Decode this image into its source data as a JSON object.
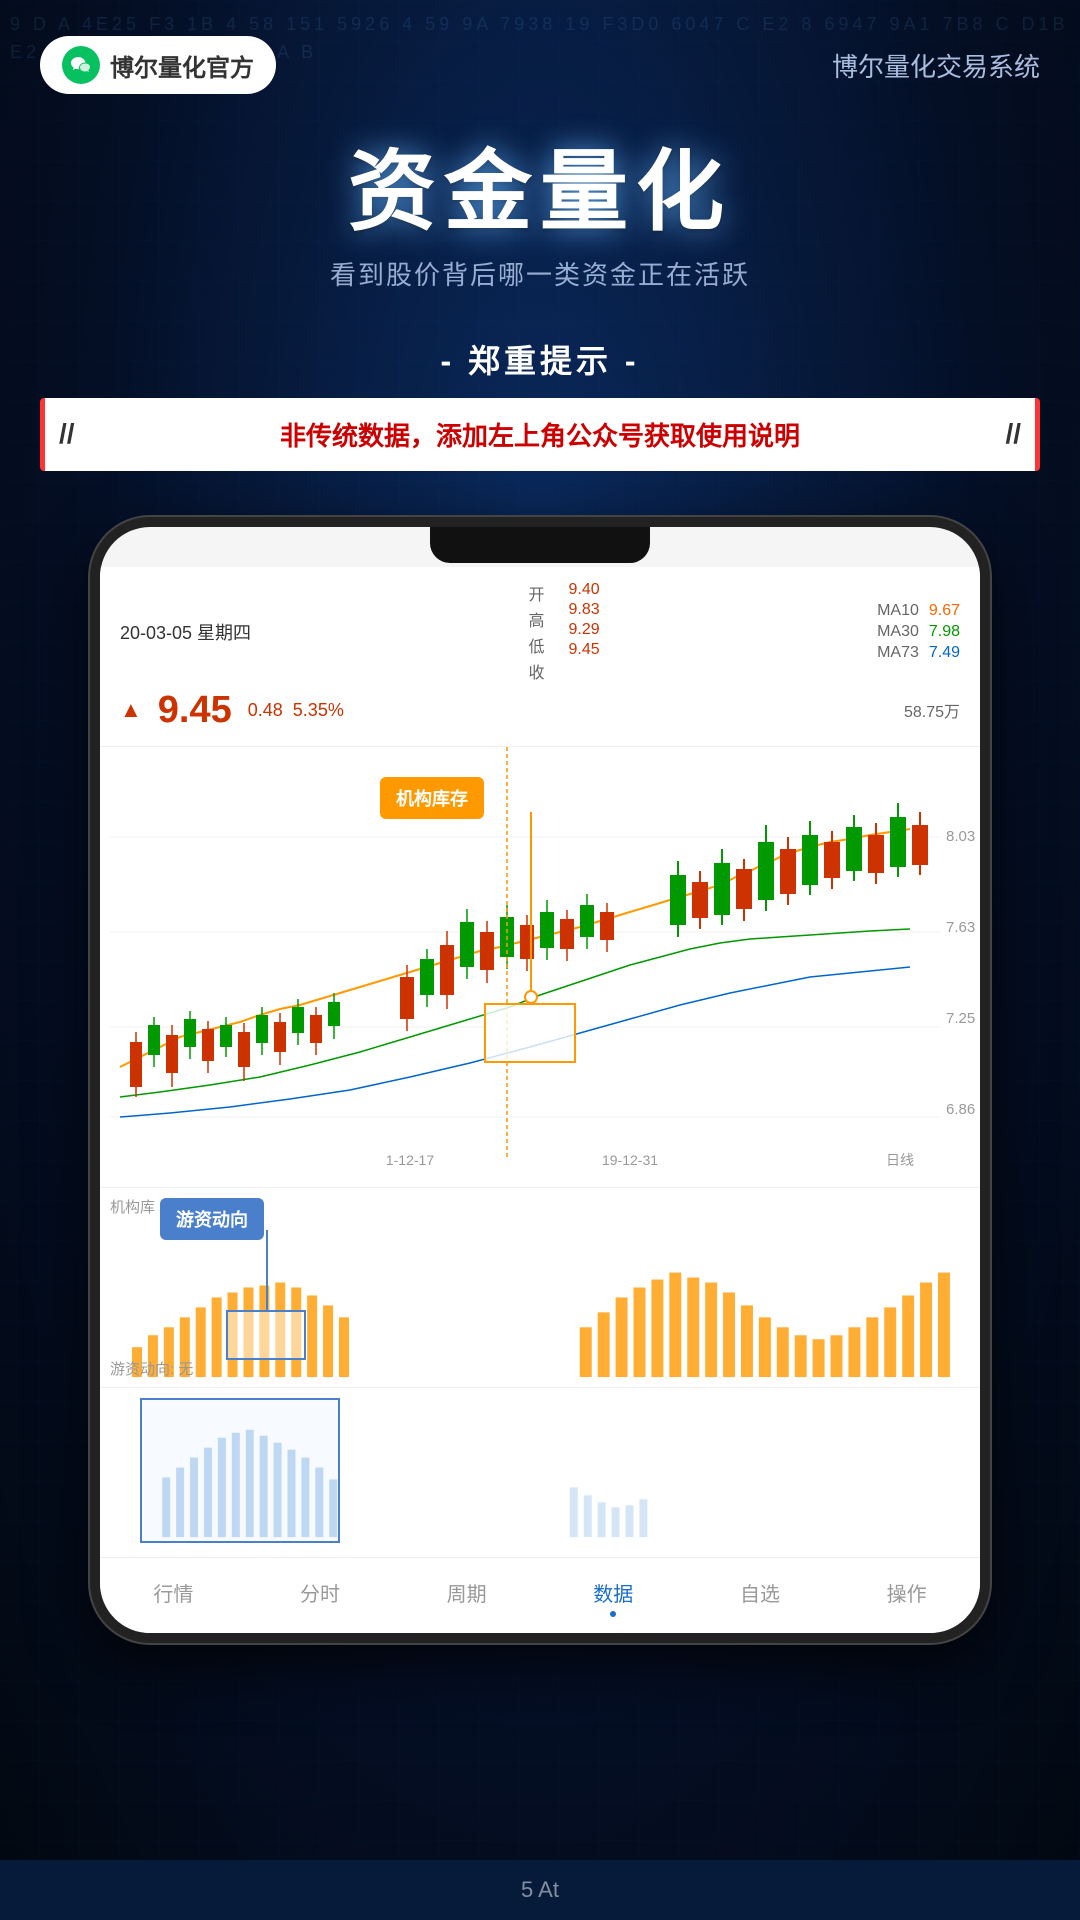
{
  "header": {
    "wechat_label": "博尔量化官方",
    "app_title": "博尔量化交易系统"
  },
  "hero": {
    "main_title": "资金量化",
    "subtitle": "看到股价背后哪一类资金正在活跃"
  },
  "notice": {
    "section_label": "- 郑重提示 -",
    "text": "非传统数据，添加左上角公众号获取使用说明"
  },
  "stock": {
    "date": "20-03-05 星期四",
    "open_label": "开",
    "high_label": "高",
    "low_label": "低",
    "close_label": "收",
    "open_val": "9.40",
    "high_val": "9.83",
    "low_val": "9.29",
    "close_val": "9.45",
    "volume_val": "58.75万",
    "price": "9.45",
    "change_abs": "0.48",
    "change_pct": "5.35%",
    "ma10_label": "MA10",
    "ma30_label": "MA30",
    "ma73_label": "MA73",
    "ma10_val": "9.67",
    "ma30_val": "7.98",
    "ma73_val": "7.49"
  },
  "chart": {
    "price_labels": [
      "8.03",
      "7.63",
      "7.25",
      "6.86"
    ],
    "date_labels": [
      {
        "text": "1-12-17",
        "pos": "38%"
      },
      {
        "text": "19-12-31",
        "pos": "62%"
      },
      {
        "text": "日线",
        "pos": "90%"
      }
    ],
    "tooltip_inventory": "机构库存",
    "tooltip_flow": "游资动向",
    "vol_label": "机构库",
    "vol_status": "游资动向: 无"
  },
  "bottom_nav": {
    "items": [
      {
        "label": "行情",
        "active": false
      },
      {
        "label": "分时",
        "active": false
      },
      {
        "label": "周期",
        "active": false
      },
      {
        "label": "数据",
        "active": true
      },
      {
        "label": "自选",
        "active": false
      },
      {
        "label": "操作",
        "active": false
      }
    ]
  },
  "system_bar": {
    "text": "5 At"
  },
  "bg_numbers": "9 D A 4E25 F3 1B 4 58 151 5926 4 59 9A 7938 19 F3D0 6047 C E2 8 6947 9A1 7B8 C D1BE2 D 5 F C0E 1B 2 F3 A B"
}
